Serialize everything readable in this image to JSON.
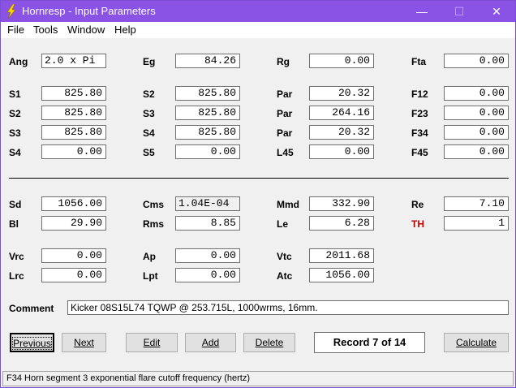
{
  "window": {
    "title": "Hornresp - Input Parameters",
    "title_bar_color": "#8a53e6"
  },
  "menu": [
    "File",
    "Tools",
    "Window",
    "Help"
  ],
  "rows": [
    [
      {
        "label": "Ang",
        "value": "2.0 x Pi"
      },
      {
        "label": "Eg",
        "value": "84.26"
      },
      {
        "label": "Rg",
        "value": "0.00"
      },
      {
        "label": "Fta",
        "value": "0.00"
      }
    ],
    [
      {
        "label": "S1",
        "value": "825.80"
      },
      {
        "label": "S2",
        "value": "825.80"
      },
      {
        "label": "Par",
        "value": "20.32"
      },
      {
        "label": "F12",
        "value": "0.00"
      }
    ],
    [
      {
        "label": "S2",
        "value": "825.80"
      },
      {
        "label": "S3",
        "value": "825.80"
      },
      {
        "label": "Par",
        "value": "264.16"
      },
      {
        "label": "F23",
        "value": "0.00"
      }
    ],
    [
      {
        "label": "S3",
        "value": "825.80"
      },
      {
        "label": "S4",
        "value": "825.80"
      },
      {
        "label": "Par",
        "value": "20.32"
      },
      {
        "label": "F34",
        "value": "0.00"
      }
    ],
    [
      {
        "label": "S4",
        "value": "0.00"
      },
      {
        "label": "S5",
        "value": "0.00"
      },
      {
        "label": "L45",
        "value": "0.00"
      },
      {
        "label": "F45",
        "value": "0.00"
      }
    ],
    [
      {
        "label": "Sd",
        "value": "1056.00"
      },
      {
        "label": "Cms",
        "value": "1.04E-04"
      },
      {
        "label": "Mmd",
        "value": "332.90"
      },
      {
        "label": "Re",
        "value": "7.10"
      }
    ],
    [
      {
        "label": "Bl",
        "value": "29.90"
      },
      {
        "label": "Rms",
        "value": "8.85"
      },
      {
        "label": "Le",
        "value": "6.28"
      },
      {
        "label": "TH",
        "value": "1"
      }
    ],
    [
      {
        "label": "Vrc",
        "value": "0.00"
      },
      {
        "label": "Ap",
        "value": "0.00"
      },
      {
        "label": "Vtc",
        "value": "2011.68"
      }
    ],
    [
      {
        "label": "Lrc",
        "value": "0.00"
      },
      {
        "label": "Lpt",
        "value": "0.00"
      },
      {
        "label": "Atc",
        "value": "1056.00"
      }
    ]
  ],
  "comment": {
    "label": "Comment",
    "value": "Kicker 08S15L74 TQWP @ 253.715L, 1000wrms, 16mm."
  },
  "buttons": {
    "previous": "Previous",
    "next": "Next",
    "edit": "Edit",
    "add": "Add",
    "delete": "Delete",
    "calculate": "Calculate"
  },
  "record": "Record 7 of 14",
  "status": "F34   Horn segment 3 exponential flare cutoff frequency  (hertz)",
  "colors": {
    "th_label": "#c00000"
  }
}
